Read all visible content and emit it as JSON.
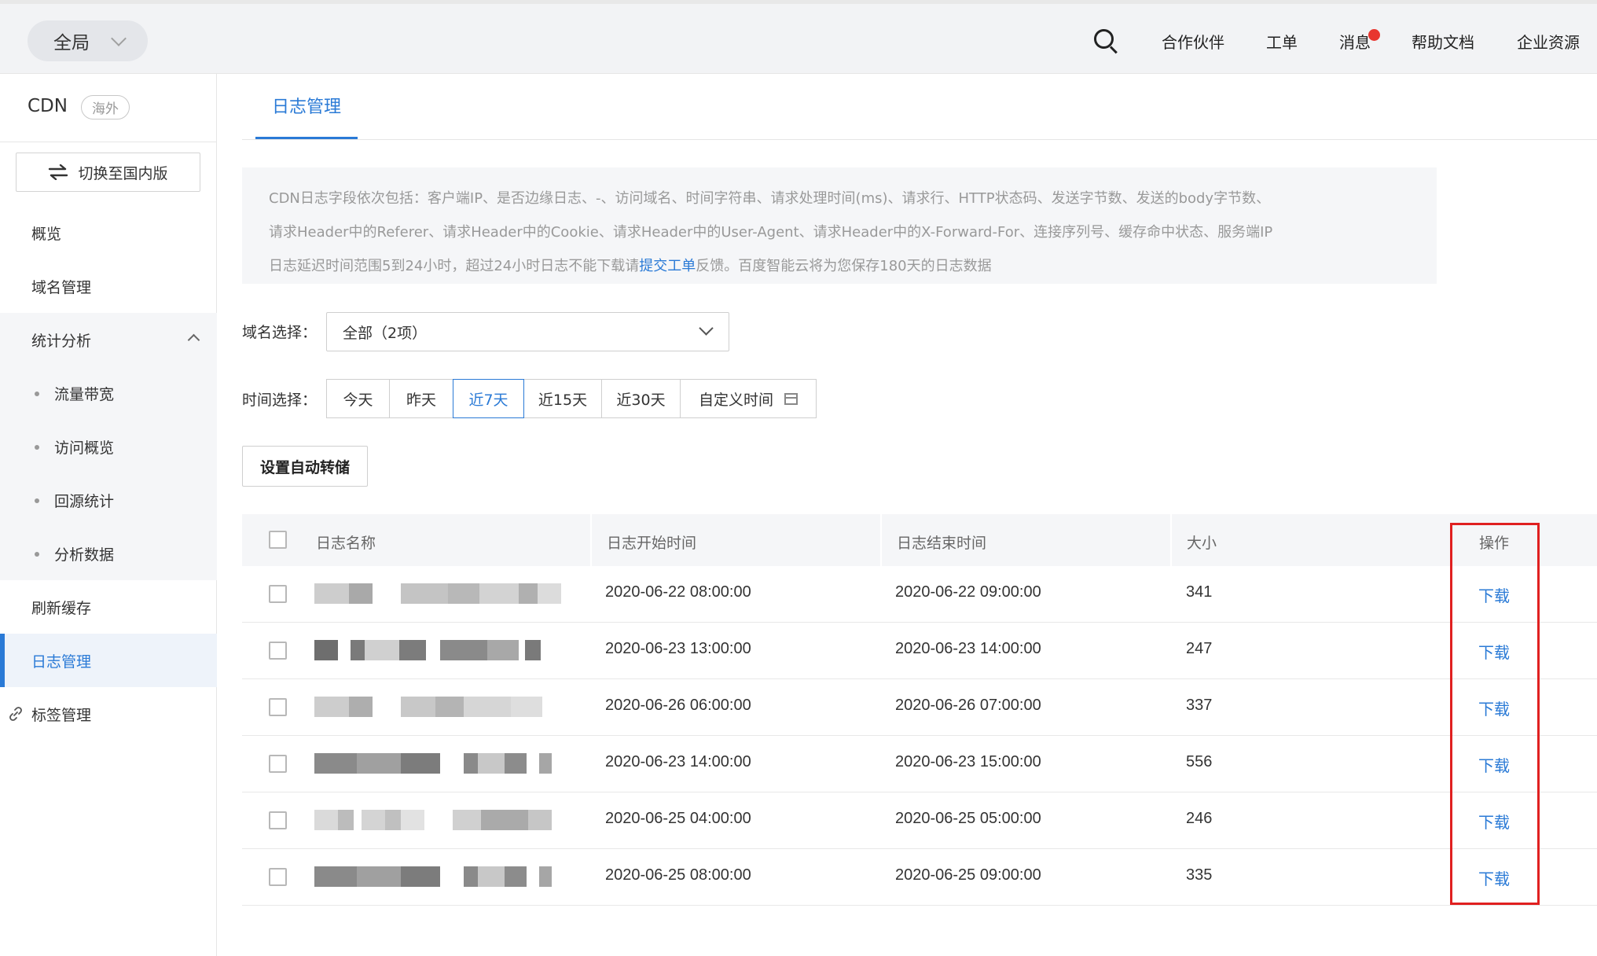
{
  "topbar": {
    "scope_label": "全局",
    "nav": [
      "合作伙伴",
      "工单",
      "消息",
      "帮助文档",
      "企业资源"
    ]
  },
  "sidebar": {
    "brand": "CDN",
    "region_tag": "海外",
    "switch_label": "切换至国内版",
    "items": {
      "overview": "概览",
      "domains": "域名管理",
      "stats": "统计分析",
      "traffic": "流量带宽",
      "visits": "访问概览",
      "origin": "回源统计",
      "analysis": "分析数据",
      "refresh": "刷新缓存",
      "logs": "日志管理",
      "tags": "标签管理"
    }
  },
  "main": {
    "tab_label": "日志管理",
    "notice": {
      "line1": "CDN日志字段依次包括：客户端IP、是否边缘日志、-、访问域名、时间字符串、请求处理时间(ms)、请求行、HTTP状态码、发送字节数、发送的body字节数、",
      "line2": "请求Header中的Referer、请求Header中的Cookie、请求Header中的User-Agent、请求Header中的X-Forward-For、连接序列号、缓存命中状态、服务端IP",
      "line3_pre": "日志延迟时间范围5到24小时，超过24小时日志不能下载请",
      "line3_link": "提交工单",
      "line3_post": "反馈。百度智能云将为您保存180天的日志数据"
    },
    "domain_label": "域名选择：",
    "domain_value": "全部（2项）",
    "time_label": "时间选择：",
    "time_options": [
      "今天",
      "昨天",
      "近7天",
      "近15天",
      "近30天",
      "自定义时间"
    ],
    "time_selected": "近7天",
    "auto_transfer_label": "设置自动转储",
    "table": {
      "headers": [
        "日志名称",
        "日志开始时间",
        "日志结束时间",
        "大小",
        "操作"
      ],
      "rows": [
        {
          "start": "2020-06-22 08:00:00",
          "end": "2020-06-22 09:00:00",
          "size": "341",
          "action": "下载"
        },
        {
          "start": "2020-06-23 13:00:00",
          "end": "2020-06-23 14:00:00",
          "size": "247",
          "action": "下载"
        },
        {
          "start": "2020-06-26 06:00:00",
          "end": "2020-06-26 07:00:00",
          "size": "337",
          "action": "下载"
        },
        {
          "start": "2020-06-23 14:00:00",
          "end": "2020-06-23 15:00:00",
          "size": "556",
          "action": "下载"
        },
        {
          "start": "2020-06-25 04:00:00",
          "end": "2020-06-25 05:00:00",
          "size": "246",
          "action": "下载"
        },
        {
          "start": "2020-06-25 08:00:00",
          "end": "2020-06-25 09:00:00",
          "size": "335",
          "action": "下载"
        }
      ]
    }
  },
  "colors": {
    "accent": "#2a7ad6",
    "notification_dot": "#e8362f",
    "highlight_box": "#e02020"
  }
}
